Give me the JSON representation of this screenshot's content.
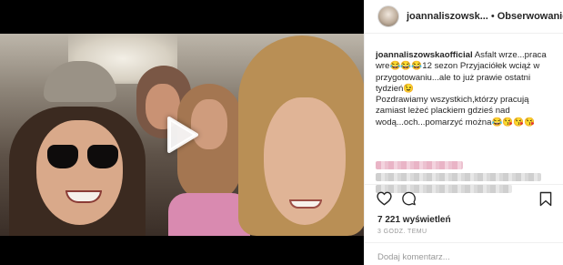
{
  "post": {
    "media": {
      "type": "video",
      "play_icon": "play-icon"
    },
    "header": {
      "username": "joannaliszowsk...",
      "separator": "•",
      "follow_label": "Obserwowanie"
    },
    "caption": {
      "author": "joannaliszowskaofficial",
      "text_part1": " Asfalt wrze...praca wre😂😂😂12 sezon Przyjaciółek wciąż w przygotowaniu...ale to już prawie ostatni tydzień😉",
      "text_part2": "Pozdrawiamy wszystkich,którzy pracują zamiast leżeć plackiem gdzieś nad wodą...och...pomarzyć można😂😘😘😘"
    },
    "actions": {
      "like_icon": "heart-icon",
      "comment_icon": "comment-icon",
      "save_icon": "bookmark-icon"
    },
    "views_label": "7 221 wyświetleń",
    "time_label": "3 GODZ. TEMU",
    "add_comment_placeholder": "Dodaj komentarz..."
  },
  "colors": {
    "text": "#262626",
    "muted": "#999999",
    "border": "#efefef",
    "media_bg": "#000000"
  }
}
